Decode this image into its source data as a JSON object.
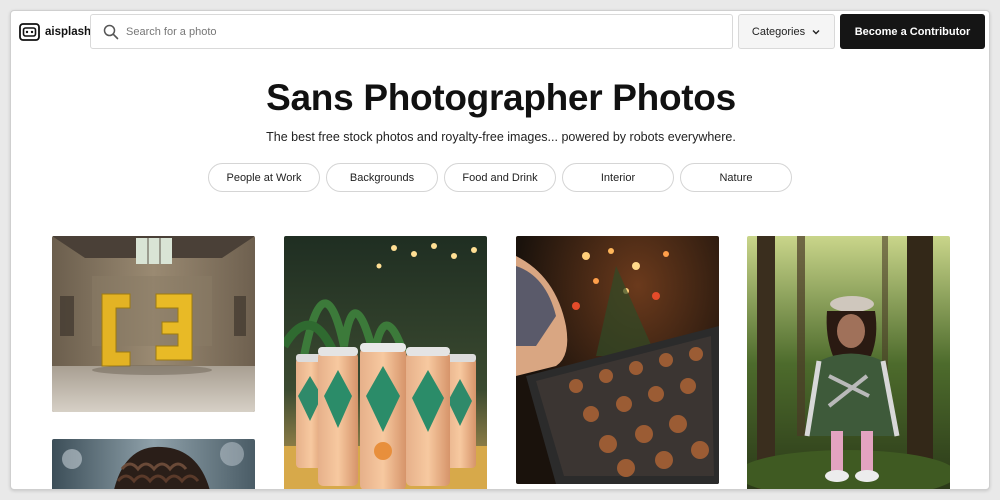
{
  "brand": {
    "name": "aisplash"
  },
  "search": {
    "placeholder": "Search for a photo"
  },
  "nav": {
    "categories_label": "Categories",
    "contribute_label": "Become a Contributor"
  },
  "hero": {
    "title": "Sans Photographer Photos",
    "subtitle": "The best free stock photos and royalty-free images... powered by robots everywhere."
  },
  "chips": [
    "People at Work",
    "Backgrounds",
    "Food and Drink",
    "Interior",
    "Nature"
  ],
  "photos": [
    {
      "subject": "abandoned hall with yellow C3 letters"
    },
    {
      "subject": "decorated cans in front of plants"
    },
    {
      "subject": "hands placing gingerbread cookies on baking tray"
    },
    {
      "subject": "young woman sitting in a forest"
    },
    {
      "subject": "child with curly hair in water"
    }
  ],
  "colors": {
    "accent": "#151515",
    "background": "#ffffff",
    "border": "#d9d9d9"
  }
}
